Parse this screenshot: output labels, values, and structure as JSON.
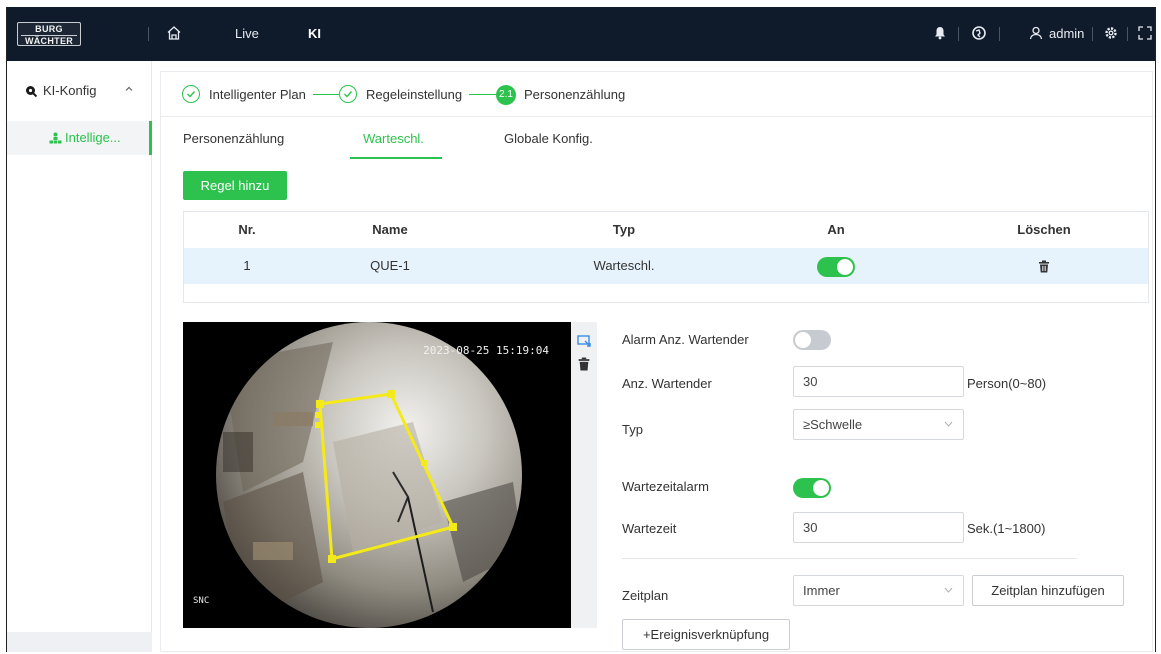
{
  "topbar": {
    "logo_line1": "BURG",
    "logo_line2": "WÄCHTER",
    "nav_live": "Live",
    "nav_ki": "KI",
    "user": "admin"
  },
  "sidebar": {
    "parent_label": "KI-Konfig",
    "child_label": "Intellige..."
  },
  "steps": [
    {
      "label": "Intelligenter Plan",
      "state": "done"
    },
    {
      "label": "Regeleinstellung",
      "state": "done"
    },
    {
      "label": "Personenzählung",
      "state": "active",
      "number": "2.1"
    }
  ],
  "tabs": [
    {
      "label": "Personenzählung",
      "active": false
    },
    {
      "label": "Warteschl.",
      "active": true
    },
    {
      "label": "Globale Konfig.",
      "active": false
    }
  ],
  "add_rule_label": "Regel hinzu",
  "table": {
    "headers": {
      "nr": "Nr.",
      "name": "Name",
      "typ": "Typ",
      "an": "An",
      "loeschen": "Löschen"
    },
    "rows": [
      {
        "nr": "1",
        "name": "QUE-1",
        "typ": "Warteschl.",
        "an": true
      }
    ]
  },
  "video": {
    "timestamp": "2023-08-25 15:19:04",
    "brand": "SNC"
  },
  "form": {
    "alarm_waiting_label": "Alarm Anz. Wartender",
    "alarm_waiting_on": false,
    "waiting_count_label": "Anz. Wartender",
    "waiting_count_value": "30",
    "waiting_count_unit": "Person(0~80)",
    "type_label": "Typ",
    "type_value": "≥Schwelle",
    "wait_alarm_label": "Wartezeitalarm",
    "wait_alarm_on": true,
    "wait_time_label": "Wartezeit",
    "wait_time_value": "30",
    "wait_time_unit": "Sek.(1~1800)",
    "schedule_label": "Zeitplan",
    "schedule_value": "Immer",
    "add_schedule_label": "Zeitplan hinzufügen",
    "event_link_label": "+Ereignisverknüpfung"
  },
  "colors": {
    "accent": "#2dc24d",
    "topbar": "#0f1a2a",
    "selected_row": "#e7f3fc"
  }
}
